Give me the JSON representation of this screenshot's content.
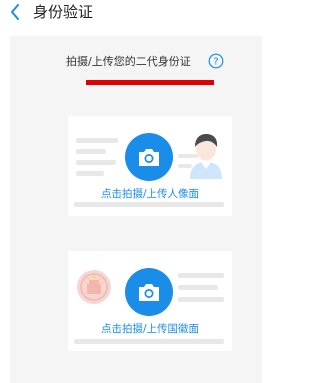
{
  "header": {
    "title": "身份验证"
  },
  "main": {
    "instruction": "拍摄/上传您的二代身份证",
    "help_symbol": "?",
    "front_card": {
      "label": "点击拍摄/上传人像面"
    },
    "back_card": {
      "label": "点击拍摄/上传国徽面"
    }
  },
  "colors": {
    "accent": "#1a8de8",
    "annotation_red": "#e00000",
    "panel_bg": "#f5f5f5"
  },
  "icons": {
    "back": "chevron-left-icon",
    "help": "question-circle-icon",
    "camera": "camera-icon"
  }
}
